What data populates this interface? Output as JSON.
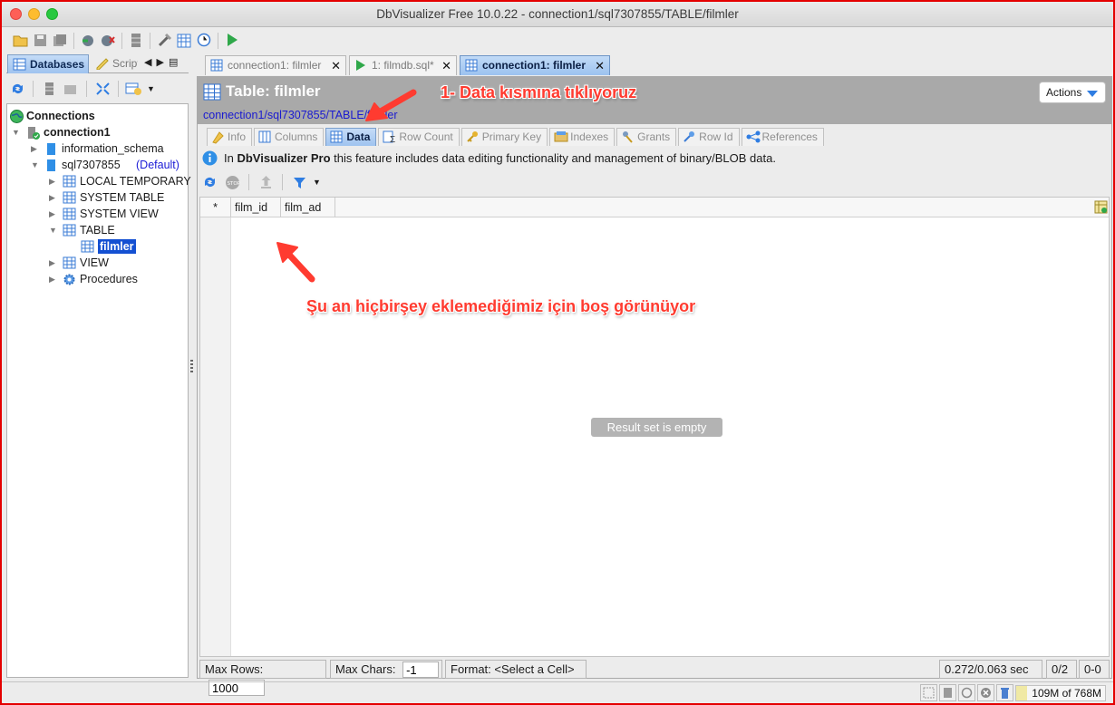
{
  "window": {
    "title": "DbVisualizer Free 10.0.22 - connection1/sql7307855/TABLE/filmler"
  },
  "left_tabs": {
    "databases": "Databases",
    "scripts": "Scripts"
  },
  "tree": {
    "connections": "Connections",
    "connection1": "connection1",
    "information_schema": "information_schema",
    "sql_db": "sql7307855",
    "sql_default": "(Default)",
    "local_temporary": "LOCAL TEMPORARY",
    "system_table": "SYSTEM TABLE",
    "system_view": "SYSTEM VIEW",
    "table": "TABLE",
    "filmler": "filmler",
    "view": "VIEW",
    "procedures": "Procedures"
  },
  "editor_tabs": [
    {
      "label": "connection1: filmler"
    },
    {
      "label": "1: filmdb.sql*"
    },
    {
      "label": "connection1: filmler"
    }
  ],
  "object": {
    "title": "Table: filmler",
    "path": "connection1/sql7307855/TABLE/filmler",
    "actions_label": "Actions"
  },
  "sub_tabs": {
    "info": "Info",
    "columns": "Columns",
    "data": "Data",
    "row_count": "Row Count",
    "primary_key": "Primary Key",
    "indexes": "Indexes",
    "grants": "Grants",
    "row_id": "Row Id",
    "references": "References"
  },
  "info_bar": {
    "prefix": "In ",
    "product": "DbVisualizer Pro",
    "suffix": " this feature includes data editing functionality and management of binary/BLOB data."
  },
  "grid": {
    "row_marker": "*",
    "columns": [
      "film_id",
      "film_ad"
    ],
    "empty_message": "Result set is empty"
  },
  "status": {
    "max_rows_label": "Max Rows:",
    "max_rows_value": "1000",
    "max_chars_label": "Max Chars:",
    "max_chars_value": "-1",
    "format_label": "Format: <Select a Cell>",
    "timing": "0.272/0.063 sec",
    "rows": "0/2",
    "range": "0-0"
  },
  "memory": "109M of 768M",
  "annotations": {
    "step1": "1- Data kısmına tıklıyoruz",
    "empty_note": "Şu an hiçbirşey eklemediğimiz için boş görünüyor"
  },
  "colors": {
    "frame": "#e40000",
    "annotation": "#ff3b30",
    "selection": "#1450d2",
    "header_gray": "#a9a9a9"
  }
}
